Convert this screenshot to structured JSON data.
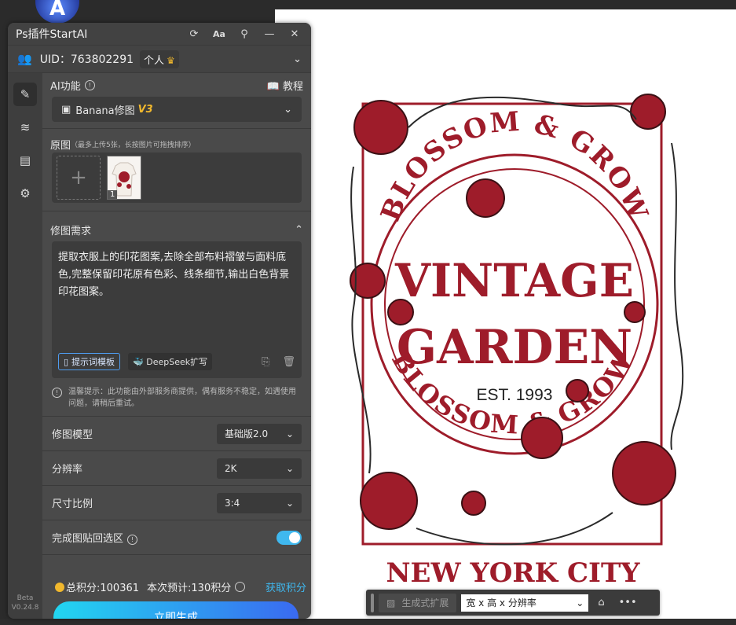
{
  "panel": {
    "title": "Ps插件StartAI",
    "version": "Beta\nV0.24.8"
  },
  "user": {
    "uid_label": "UID：763802291",
    "plan": "个人"
  },
  "ai_function": {
    "label": "AI功能",
    "tutorial": "教程",
    "selected": "Banana修图",
    "badge": "V3"
  },
  "source_image": {
    "label": "原图",
    "note": "（最多上传5张，长按图片可拖拽排序）",
    "thumb_index": "1"
  },
  "requirements": {
    "label": "修图需求",
    "text": "提取衣服上的印花图案,去除全部布料褶皱与面料底色,完整保留印花原有色彩、线条细节,输出白色背景印花图案。",
    "template_btn": "提示词模板",
    "deepseek_btn": "DeepSeek扩写"
  },
  "hint": "温馨提示：此功能由外部服务商提供，偶有服务不稳定，如遇使用问题，请稍后重试。",
  "settings": {
    "model_label": "修图模型",
    "model_value": "基础版2.0",
    "resolution_label": "分辨率",
    "resolution_value": "2K",
    "ratio_label": "尺寸比例",
    "ratio_value": "3:4",
    "paste_label": "完成图贴回选区"
  },
  "footer": {
    "points": "总积分:100361",
    "estimate": "本次预计:130积分",
    "get_points": "获取积分",
    "generate": "立即生成"
  },
  "float_toolbar": {
    "expand": "生成式扩展",
    "size_select": "宽 x 高 x 分辨率"
  },
  "artwork": {
    "arc_top": "BLOSSOM & GROW",
    "line1": "VINTAGE",
    "line2": "GARDEN",
    "est": "EST. 1993",
    "arc_bottom": "BLOSSOM & GROW",
    "city": "NEW YORK CITY"
  },
  "colors": {
    "accent": "#3fb8ef",
    "brand_gold": "#f1b82d",
    "art_red": "#9e1c2a"
  }
}
